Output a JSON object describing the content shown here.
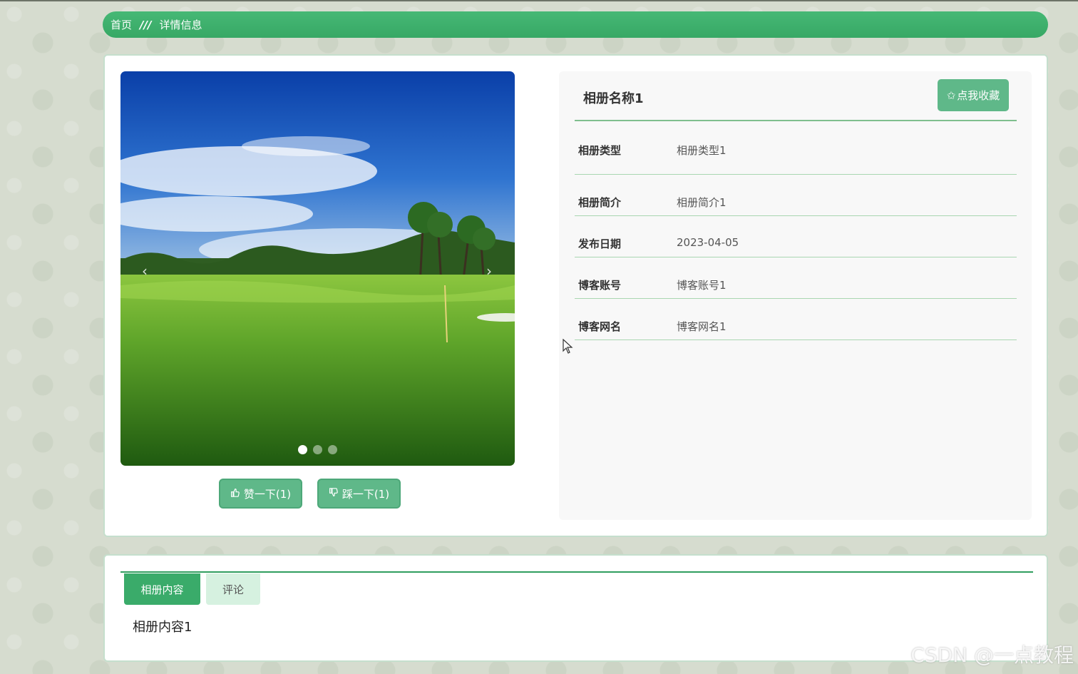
{
  "breadcrumb": {
    "home": "首页",
    "separator": "///",
    "current": "详情信息"
  },
  "carousel": {
    "prev_icon": "chevron-left-icon",
    "next_icon": "chevron-right-icon",
    "slide_count": 3,
    "active_slide": 1
  },
  "votes": {
    "up": {
      "label": "赞一下(1)",
      "icon": "thumbs-up-icon"
    },
    "down": {
      "label": "踩一下(1)",
      "icon": "thumbs-down-icon"
    }
  },
  "detail": {
    "title": "相册名称1",
    "favorite_label": "点我收藏",
    "favorite_icon": "star-icon",
    "fields": [
      {
        "label": "相册类型",
        "value": "相册类型1"
      },
      {
        "label": "相册简介",
        "value": "相册简介1"
      },
      {
        "label": "发布日期",
        "value": "2023-04-05"
      },
      {
        "label": "博客账号",
        "value": "博客账号1"
      },
      {
        "label": "博客网名",
        "value": "博客网名1"
      }
    ]
  },
  "tabs": [
    {
      "label": "相册内容",
      "active": true
    },
    {
      "label": "评论",
      "active": false
    }
  ],
  "tab_content": "相册内容1",
  "watermark": "CSDN @一点教程",
  "colors": {
    "primary": "#3aab6a",
    "button": "#5fb889",
    "divider": "#7fbf8e"
  }
}
